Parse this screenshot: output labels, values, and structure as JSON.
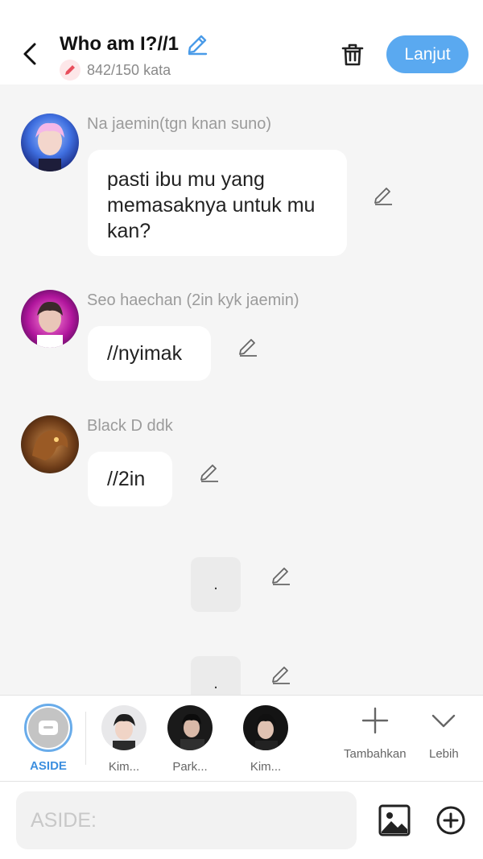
{
  "header": {
    "title": "Who am I?//1",
    "word_count": "842/150 kata",
    "next_label": "Lanjut",
    "accent_color": "#5aa9f0"
  },
  "messages": [
    {
      "sender": "Na jaemin(tgn knan suno)",
      "text": "pasti ibu mu yang memasaknya untuk mu kan?"
    },
    {
      "sender": "Seo haechan (2in kyk jaemin)",
      "text": "//nyimak"
    },
    {
      "sender": "Black D ddk",
      "text": "//2in"
    }
  ],
  "narrations": [
    {
      "text": "."
    },
    {
      "text": "."
    }
  ],
  "characters": {
    "aside_label": "ASIDE",
    "items": [
      {
        "label": "Kim..."
      },
      {
        "label": "Park..."
      },
      {
        "label": "Kim..."
      }
    ],
    "add_label": "Tambahkan",
    "more_label": "Lebih"
  },
  "composer": {
    "placeholder": "ASIDE:",
    "value": ""
  },
  "icons": [
    "back-icon",
    "pencil-icon",
    "trash-icon",
    "image-icon",
    "plus-circle-icon",
    "plus-icon",
    "chevron-down-icon"
  ]
}
